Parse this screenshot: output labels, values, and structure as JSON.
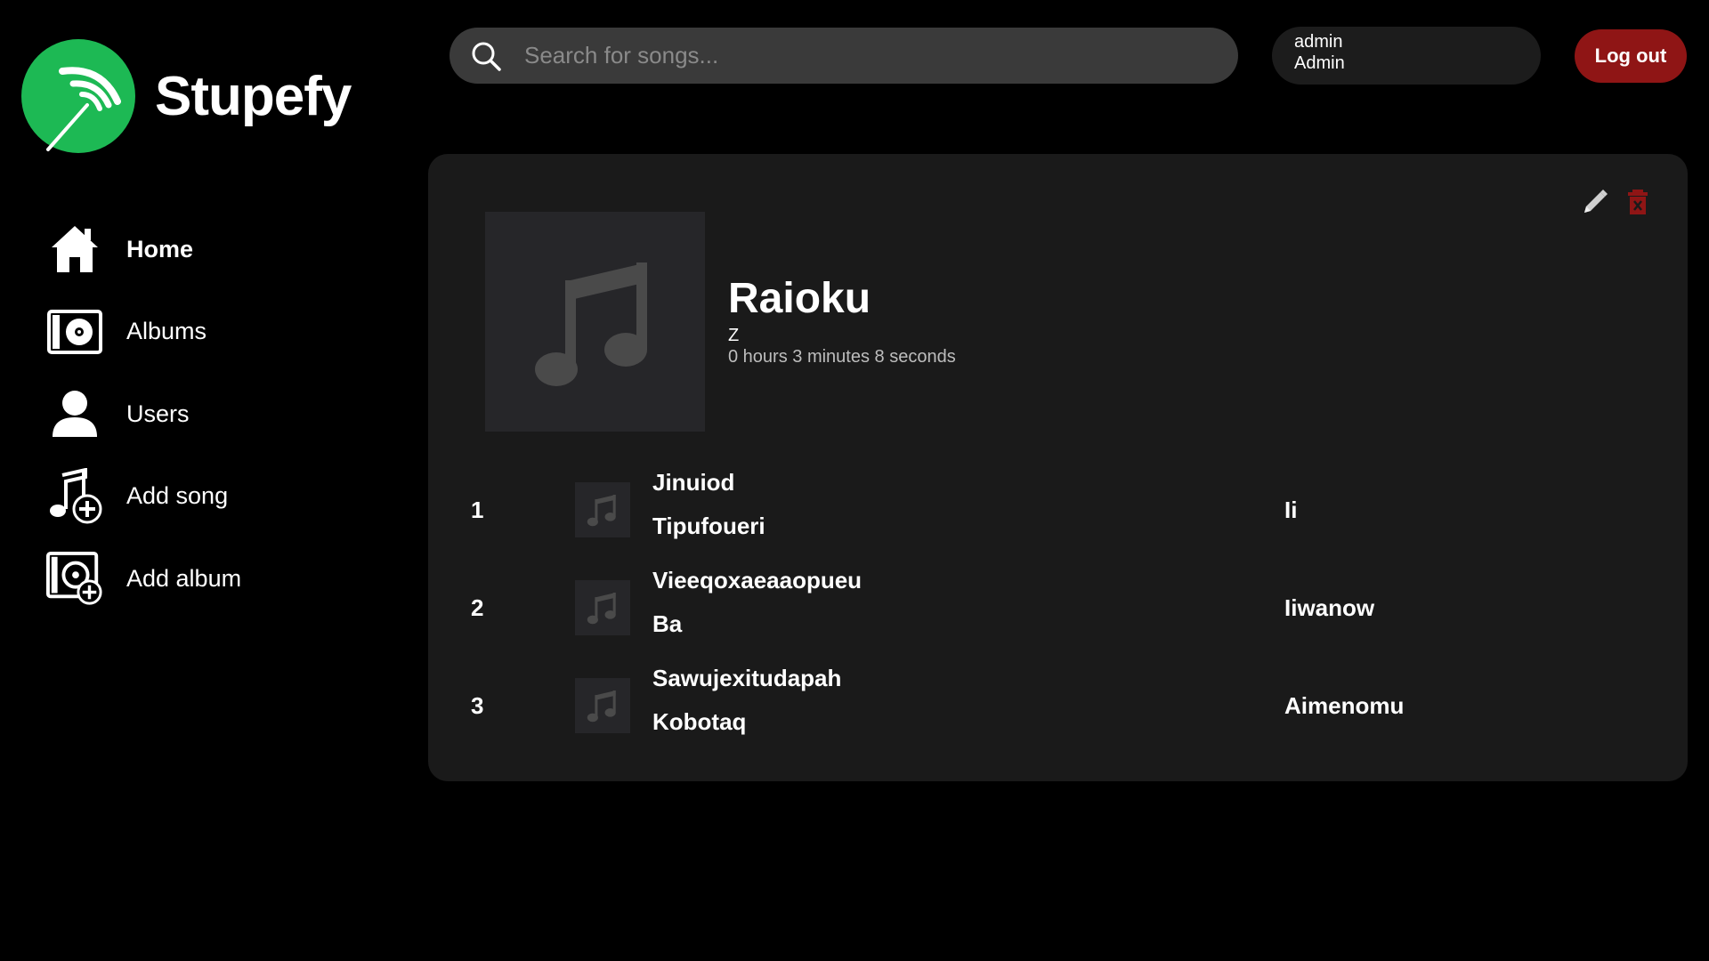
{
  "app": {
    "name": "Stupefy",
    "brand_color": "#1DB954",
    "logout_color": "#8F1515"
  },
  "sidebar": {
    "items": [
      {
        "label": "Home",
        "icon": "home-icon",
        "active": true
      },
      {
        "label": "Albums",
        "icon": "album-icon",
        "active": false
      },
      {
        "label": "Users",
        "icon": "user-icon",
        "active": false
      },
      {
        "label": "Add song",
        "icon": "add-song-icon",
        "active": false
      },
      {
        "label": "Add album",
        "icon": "add-album-icon",
        "active": false
      }
    ]
  },
  "header": {
    "search": {
      "placeholder": "Search for songs...",
      "value": ""
    },
    "user": {
      "username": "admin",
      "role": "Admin"
    },
    "logout_label": "Log out"
  },
  "album": {
    "title": "Raioku",
    "artist": "Z",
    "duration": "0 hours 3 minutes 8 seconds",
    "actions": [
      "edit-icon",
      "delete-icon"
    ],
    "tracks": [
      {
        "number": "1",
        "title": "Jinuiod",
        "subtitle": "Tipufoueri",
        "artist": "Ii"
      },
      {
        "number": "2",
        "title": "Vieeqoxaeaaopueu",
        "subtitle": "Ba",
        "artist": "Iiwanow"
      },
      {
        "number": "3",
        "title": "Sawujexitudapah",
        "subtitle": "Kobotaq",
        "artist": "Aimenomu"
      }
    ]
  }
}
